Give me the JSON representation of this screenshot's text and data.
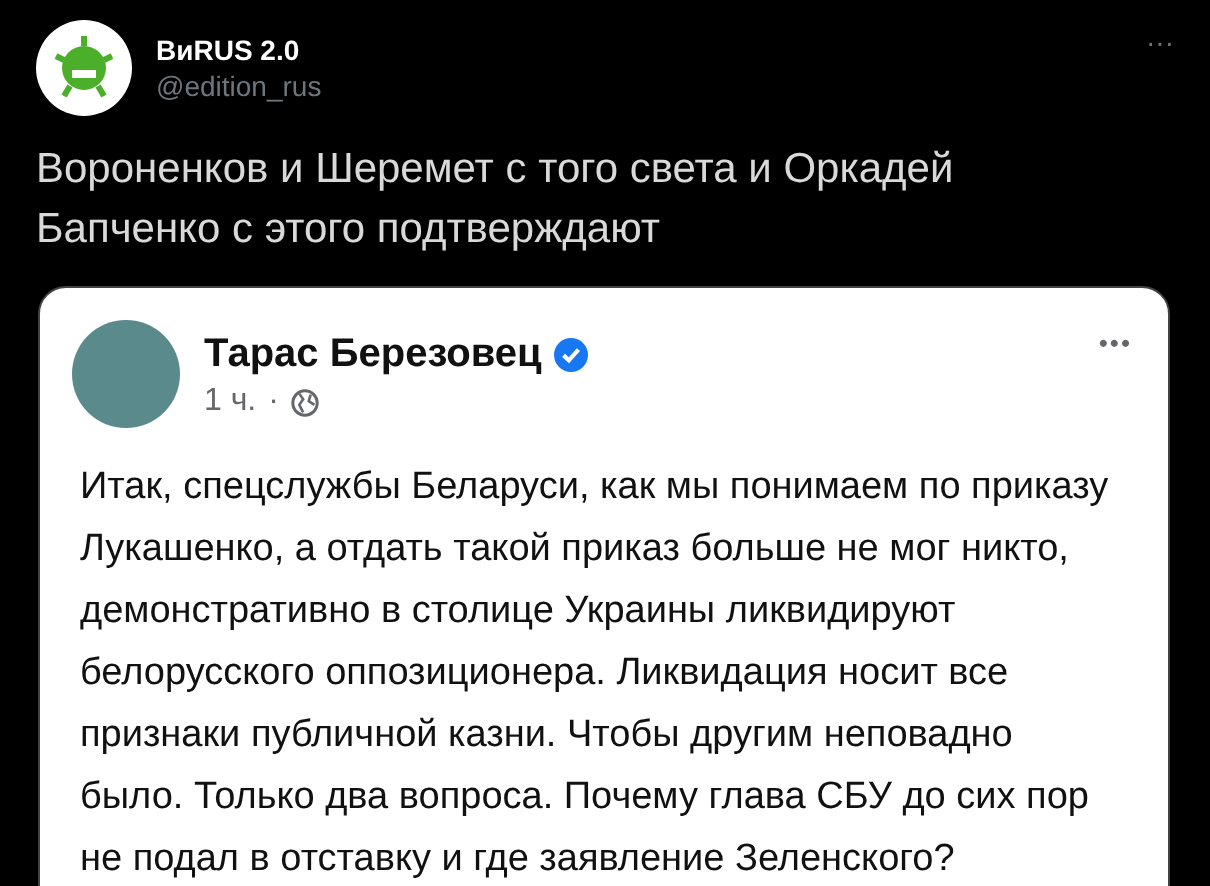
{
  "tweet": {
    "author": {
      "name": "ВиRUS 2.0",
      "handle": "@edition_rus"
    },
    "more": "···",
    "text": "Вороненков и Шеремет с того света и Оркадей Бапченко с этого подтверждают"
  },
  "embedded_post": {
    "author": {
      "name": "Тарас Березовец",
      "verified": true
    },
    "time": "1 ч.",
    "separator": "·",
    "more": "•••",
    "text": "Итак, спецслужбы Беларуси, как мы понимаем по приказу Лукашенко, а отдать такой приказ больше не мог никто, демонстративно в столице Украины ликвидируют белорусского оппозиционера. Ликвидация носит все признаки публичной казни. Чтобы другим неповадно было. Только два вопроса. Почему глава СБУ до сих пор не подал в отставку и где заявление Зеленского?"
  }
}
